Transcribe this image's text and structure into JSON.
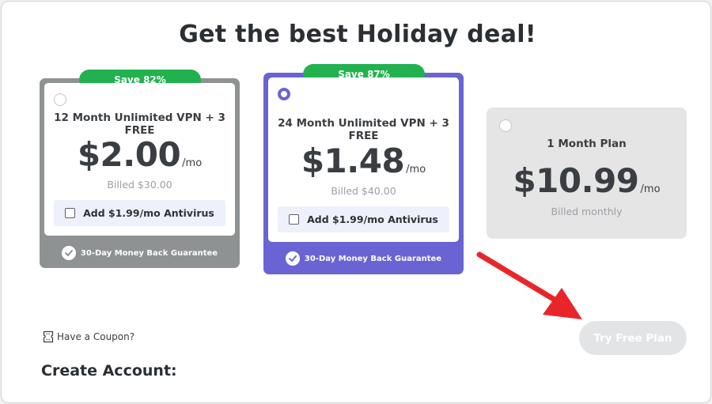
{
  "headline": "Get the best Holiday deal!",
  "plans": [
    {
      "ribbon": "Save 82%",
      "name": "12 Month Unlimited VPN + 3 FREE",
      "price": "$2.00",
      "per": "/mo",
      "billed": "Billed $30.00",
      "addon": "Add $1.99/mo Antivirus",
      "guarantee": "30-Day Money Back Guarantee",
      "selected": false
    },
    {
      "ribbon": "Save 87%",
      "name": "24 Month Unlimited VPN + 3 FREE",
      "price": "$1.48",
      "per": "/mo",
      "billed": "Billed $40.00",
      "addon": "Add $1.99/mo Antivirus",
      "guarantee": "30-Day Money Back Guarantee",
      "selected": true
    },
    {
      "name": "1 Month Plan",
      "price": "$10.99",
      "per": "/mo",
      "billed": "Billed monthly",
      "selected": false
    }
  ],
  "coupon_label": "Have a Coupon?",
  "try_free_label": "Try Free Plan",
  "create_account_label": "Create Account:",
  "colors": {
    "save_ribbon": "#21b24f",
    "selected_plan": "#6a63d4",
    "unselected_plan": "#8f9293",
    "annotation_arrow": "#e8262a"
  },
  "icons": [
    "radio-icon",
    "checkbox-icon",
    "check-badge-icon",
    "coupon-icon",
    "annotation-arrow"
  ]
}
